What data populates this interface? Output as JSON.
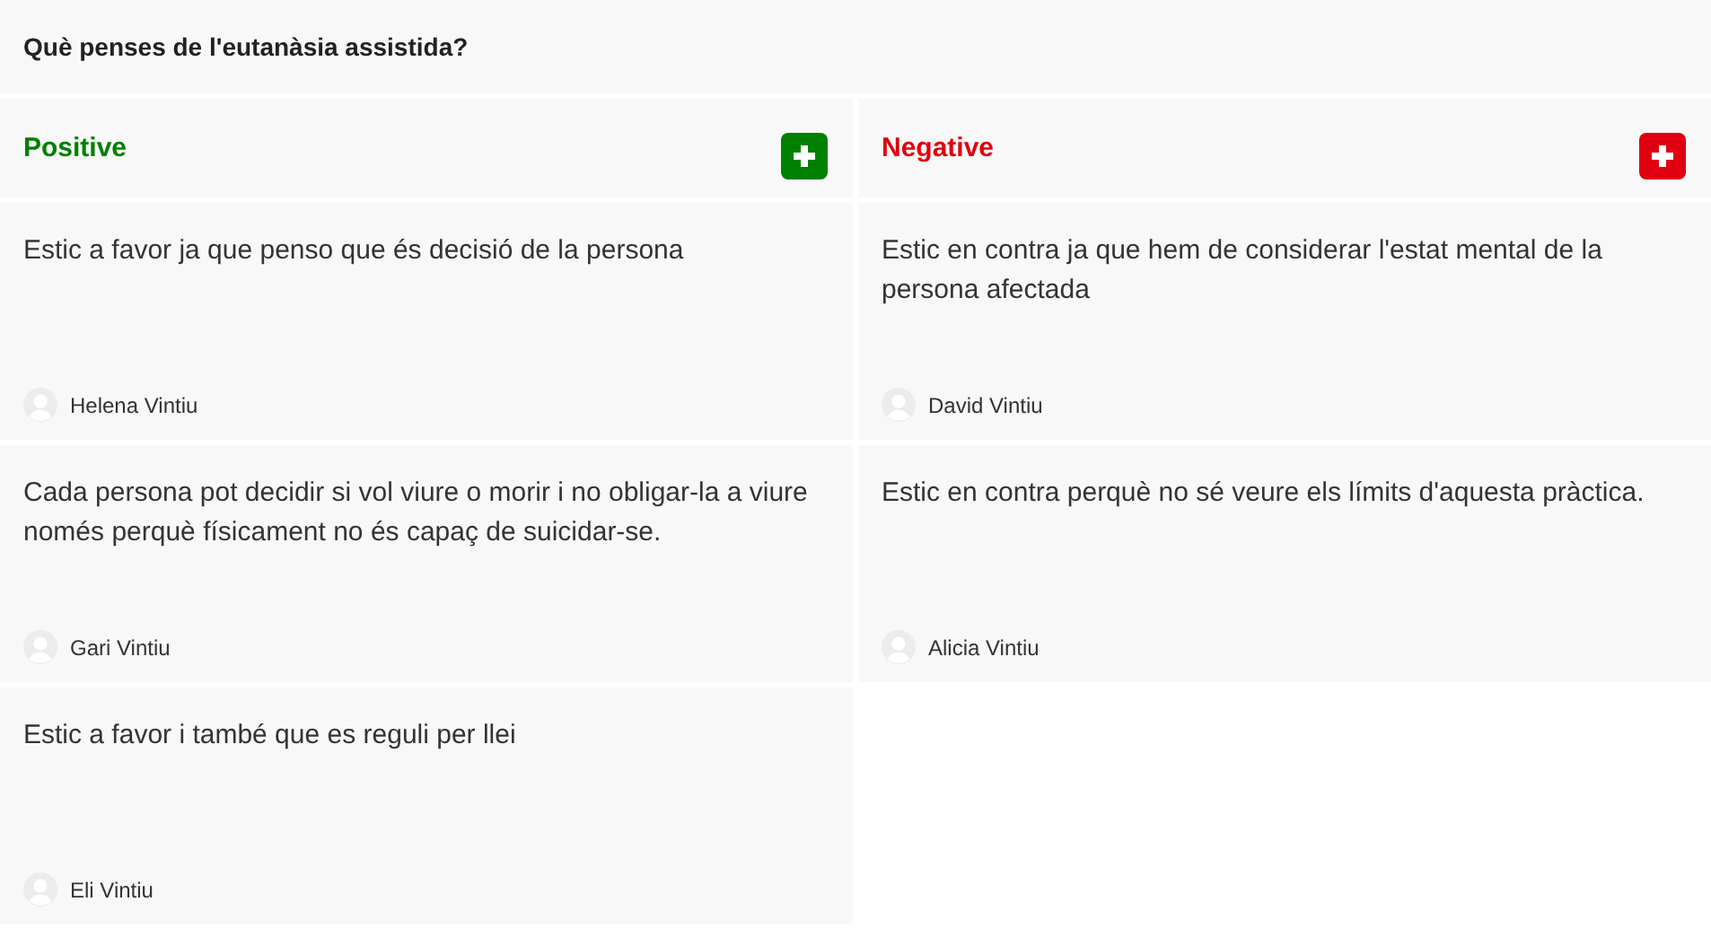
{
  "question": "Què penses de l'eutanàsia assistida?",
  "columns": [
    {
      "title": "Positive",
      "color": "#008000",
      "cards": [
        {
          "text": "Estic a favor ja que penso que és decisió de la persona",
          "author": "Helena Vintiu"
        },
        {
          "text": "Cada persona pot decidir si vol viure o morir i no obligar-la a viure només perquè físicament no és capaç de suicidar-se.",
          "author": "Gari Vintiu"
        },
        {
          "text": "Estic a favor i també que es reguli per llei",
          "author": "Eli Vintiu"
        }
      ]
    },
    {
      "title": "Negative",
      "color": "#e0000f",
      "cards": [
        {
          "text": "Estic en contra ja que hem de considerar l'estat mental de la persona afectada",
          "author": "David Vintiu"
        },
        {
          "text": "Estic en contra perquè no sé veure els límits d'aquesta pràctica.",
          "author": "Alicia Vintiu"
        }
      ]
    }
  ]
}
